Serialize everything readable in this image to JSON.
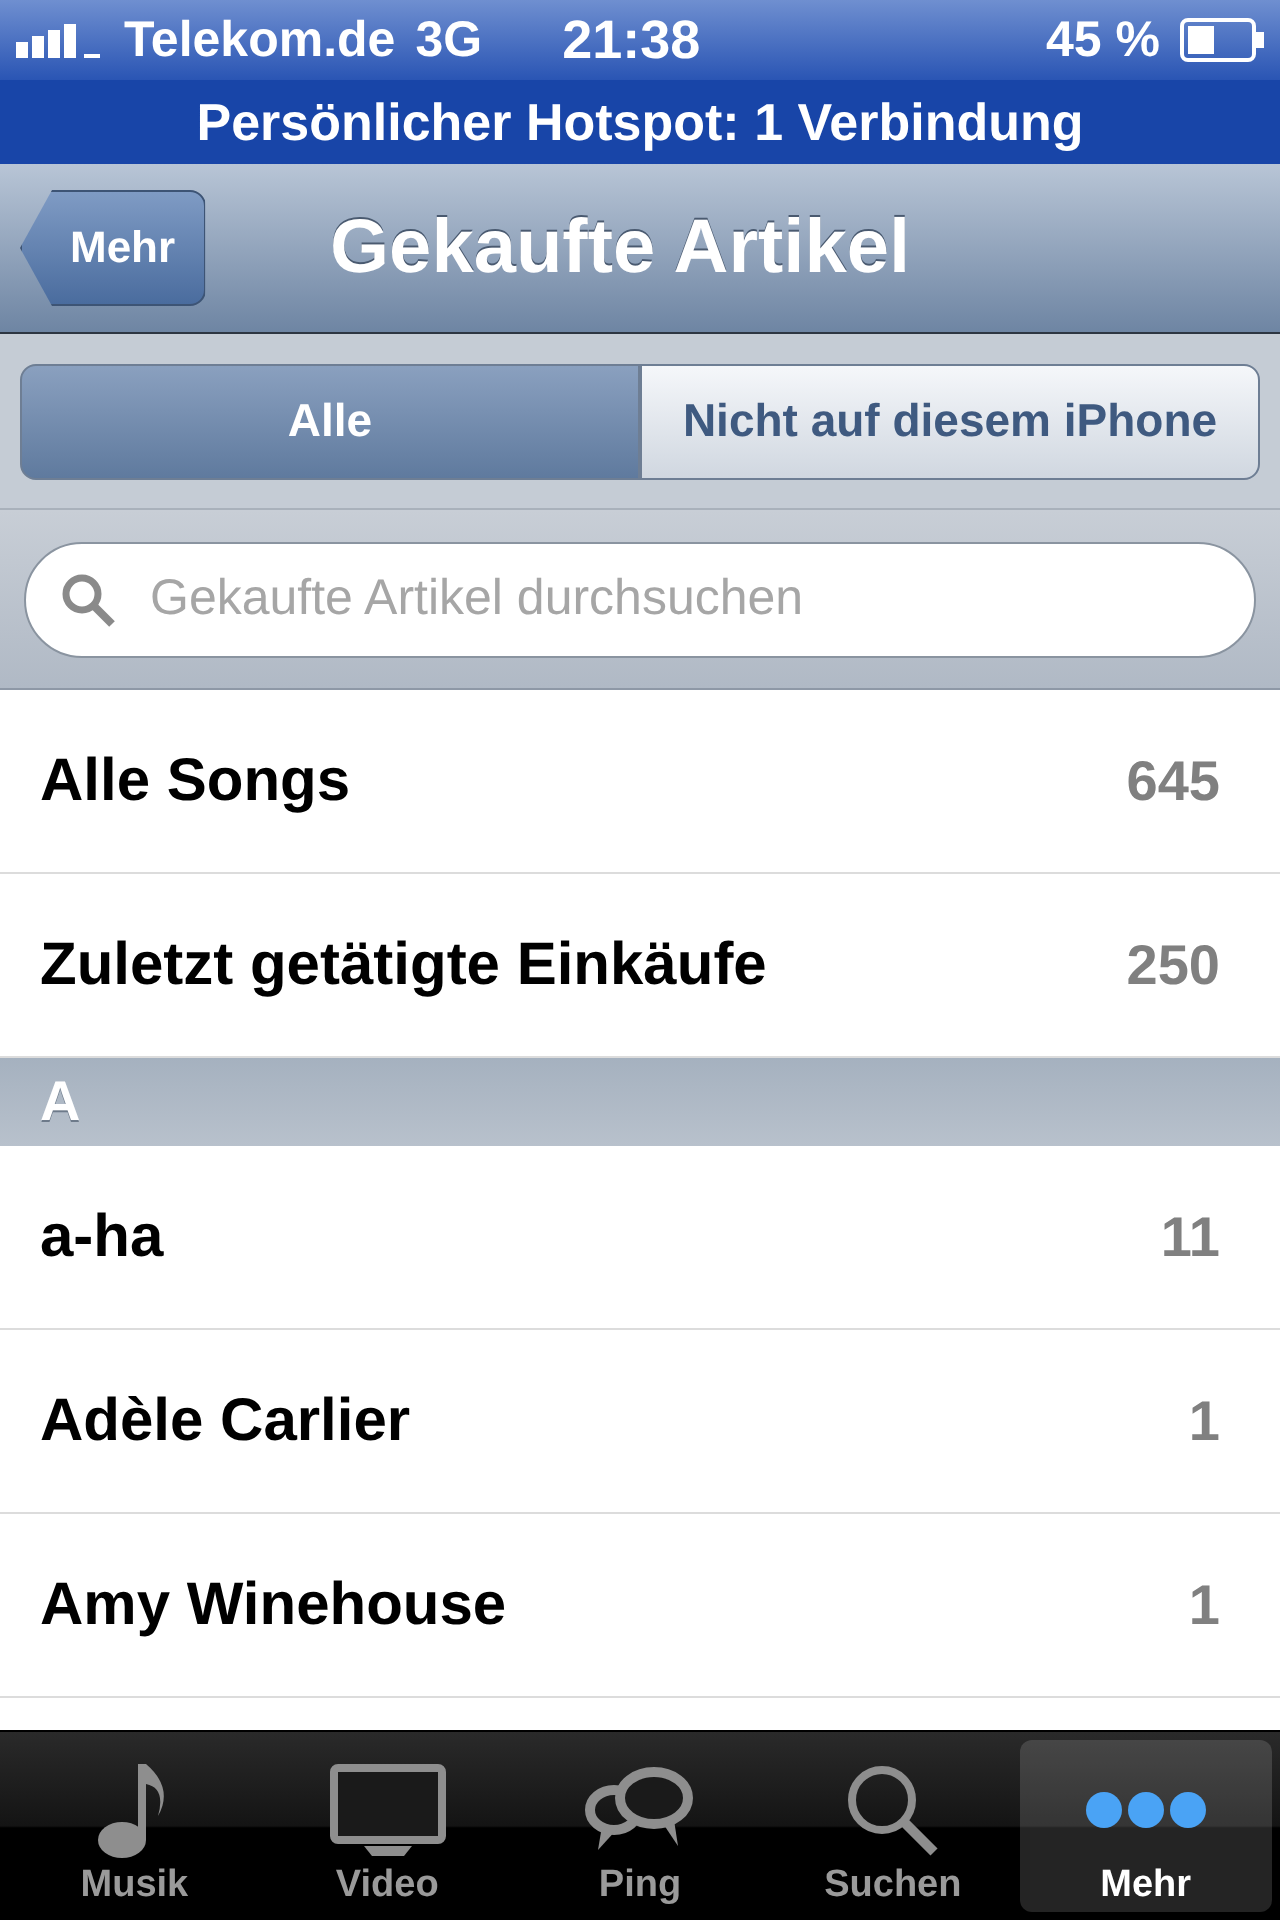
{
  "status_bar": {
    "carrier": "Telekom.de",
    "network": "3G",
    "time": "21:38",
    "battery": "45 %"
  },
  "hotspot_banner": "Persönlicher Hotspot: 1 Verbindung",
  "nav_bar": {
    "back": "Mehr",
    "title": "Gekaufte Artikel"
  },
  "segments": [
    {
      "label": "Alle",
      "selected": true
    },
    {
      "label": "Nicht auf diesem iPhone",
      "selected": false
    }
  ],
  "search": {
    "placeholder": "Gekaufte Artikel durchsuchen"
  },
  "top_rows": [
    {
      "label": "Alle Songs",
      "count": "645"
    },
    {
      "label": "Zuletzt getätigte Einkäufe",
      "count": "250"
    }
  ],
  "section": {
    "header": "A",
    "rows": [
      {
        "label": "a-ha",
        "count": "11"
      },
      {
        "label": "Adèle Carlier",
        "count": "1"
      },
      {
        "label": "Amy Winehouse",
        "count": "1"
      }
    ]
  },
  "tab_bar": [
    {
      "label": "Musik",
      "kind": "music",
      "selected": false
    },
    {
      "label": "Video",
      "kind": "video",
      "selected": false
    },
    {
      "label": "Ping",
      "kind": "ping",
      "selected": false
    },
    {
      "label": "Suchen",
      "kind": "search",
      "selected": false
    },
    {
      "label": "Mehr",
      "kind": "more",
      "selected": true
    }
  ]
}
